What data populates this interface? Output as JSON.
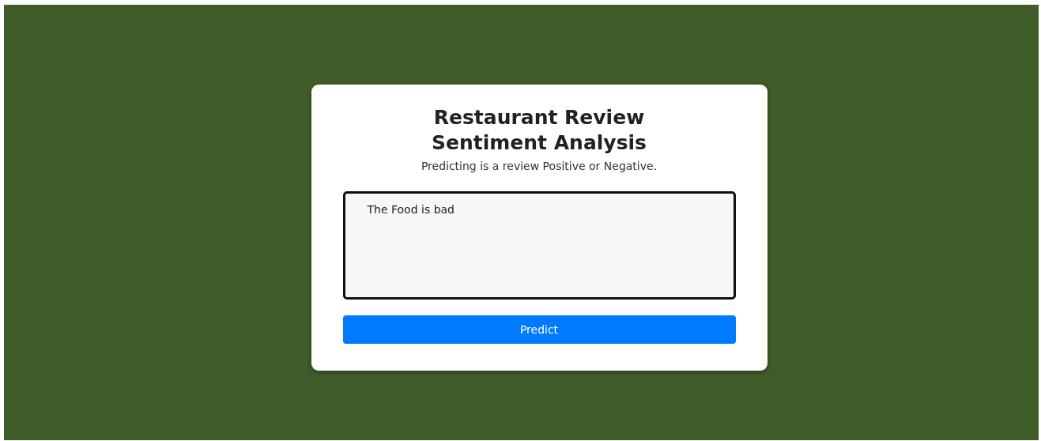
{
  "card": {
    "title": "Restaurant Review Sentiment Analysis",
    "subtitle": "Predicting is a review Positive or Negative.",
    "review_field": {
      "value": "The Food is bad"
    },
    "button": "Predict"
  }
}
